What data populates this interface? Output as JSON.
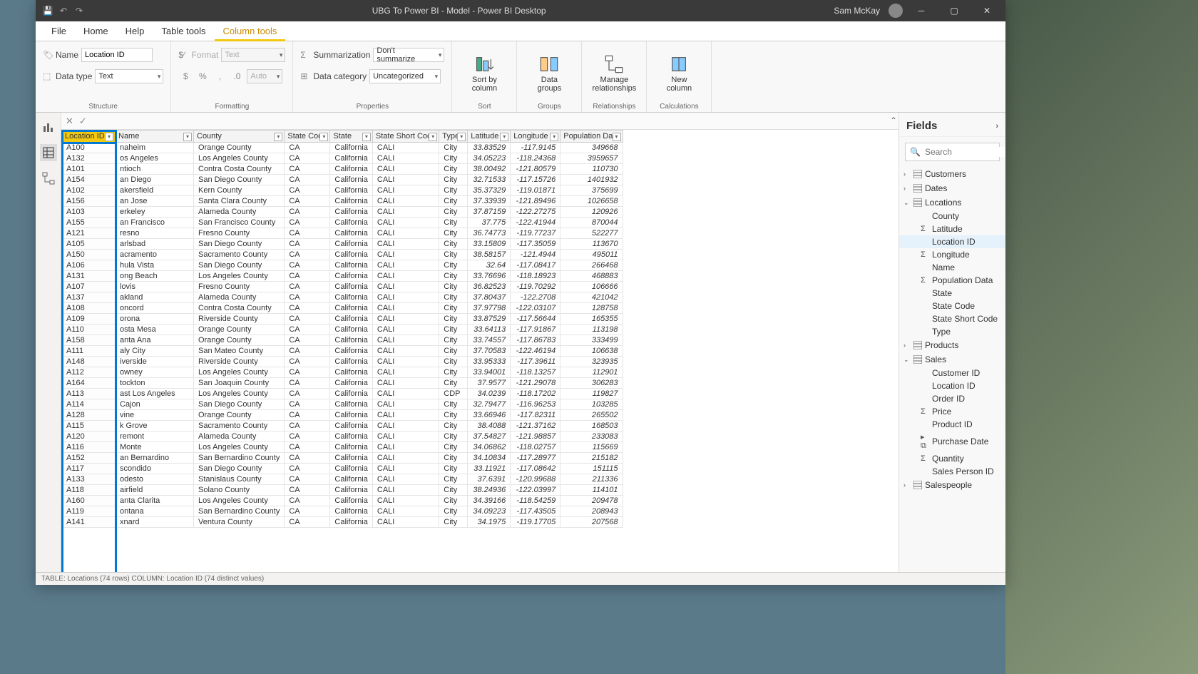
{
  "titlebar": {
    "title": "UBG To Power BI - Model - Power BI Desktop",
    "user": "Sam McKay"
  },
  "ribbon": {
    "tabs": [
      "File",
      "Home",
      "Help",
      "Table tools",
      "Column tools"
    ],
    "active_tab": "Column tools",
    "name_label": "Name",
    "name_value": "Location ID",
    "datatype_label": "Data type",
    "datatype_value": "Text",
    "format_label": "Format",
    "format_value": "Text",
    "auto_value": "Auto",
    "summarization_label": "Summarization",
    "summarization_value": "Don't summarize",
    "datacat_label": "Data category",
    "datacat_value": "Uncategorized",
    "sort_label": "Sort by\ncolumn",
    "groups_label": "Data\ngroups",
    "manage_label": "Manage\nrelationships",
    "newcol_label": "New\ncolumn",
    "grp_structure": "Structure",
    "grp_formatting": "Formatting",
    "grp_properties": "Properties",
    "grp_sort": "Sort",
    "grp_groups": "Groups",
    "grp_rel": "Relationships",
    "grp_calc": "Calculations"
  },
  "columns": [
    "Location ID",
    "Name",
    "County",
    "State Code",
    "State",
    "State Short Code",
    "Type",
    "Latitude",
    "Longitude",
    "Population Data"
  ],
  "rows": [
    [
      "A100",
      "naheim",
      "Orange County",
      "CA",
      "California",
      "CALI",
      "City",
      "33.83529",
      "-117.9145",
      "349668"
    ],
    [
      "A132",
      "os Angeles",
      "Los Angeles County",
      "CA",
      "California",
      "CALI",
      "City",
      "34.05223",
      "-118.24368",
      "3959657"
    ],
    [
      "A101",
      "ntioch",
      "Contra Costa County",
      "CA",
      "California",
      "CALI",
      "City",
      "38.00492",
      "-121.80579",
      "110730"
    ],
    [
      "A154",
      "an Diego",
      "San Diego County",
      "CA",
      "California",
      "CALI",
      "City",
      "32.71533",
      "-117.15726",
      "1401932"
    ],
    [
      "A102",
      "akersfield",
      "Kern County",
      "CA",
      "California",
      "CALI",
      "City",
      "35.37329",
      "-119.01871",
      "375699"
    ],
    [
      "A156",
      "an Jose",
      "Santa Clara County",
      "CA",
      "California",
      "CALI",
      "City",
      "37.33939",
      "-121.89496",
      "1026658"
    ],
    [
      "A103",
      "erkeley",
      "Alameda County",
      "CA",
      "California",
      "CALI",
      "City",
      "37.87159",
      "-122.27275",
      "120926"
    ],
    [
      "A155",
      "an Francisco",
      "San Francisco County",
      "CA",
      "California",
      "CALI",
      "City",
      "37.775",
      "-122.41944",
      "870044"
    ],
    [
      "A121",
      "resno",
      "Fresno County",
      "CA",
      "California",
      "CALI",
      "City",
      "36.74773",
      "-119.77237",
      "522277"
    ],
    [
      "A105",
      "arlsbad",
      "San Diego County",
      "CA",
      "California",
      "CALI",
      "City",
      "33.15809",
      "-117.35059",
      "113670"
    ],
    [
      "A150",
      "acramento",
      "Sacramento County",
      "CA",
      "California",
      "CALI",
      "City",
      "38.58157",
      "-121.4944",
      "495011"
    ],
    [
      "A106",
      "hula Vista",
      "San Diego County",
      "CA",
      "California",
      "CALI",
      "City",
      "32.64",
      "-117.08417",
      "266468"
    ],
    [
      "A131",
      "ong Beach",
      "Los Angeles County",
      "CA",
      "California",
      "CALI",
      "City",
      "33.76696",
      "-118.18923",
      "468883"
    ],
    [
      "A107",
      "lovis",
      "Fresno County",
      "CA",
      "California",
      "CALI",
      "City",
      "36.82523",
      "-119.70292",
      "106666"
    ],
    [
      "A137",
      "akland",
      "Alameda County",
      "CA",
      "California",
      "CALI",
      "City",
      "37.80437",
      "-122.2708",
      "421042"
    ],
    [
      "A108",
      "oncord",
      "Contra Costa County",
      "CA",
      "California",
      "CALI",
      "City",
      "37.97798",
      "-122.03107",
      "128758"
    ],
    [
      "A109",
      "orona",
      "Riverside County",
      "CA",
      "California",
      "CALI",
      "City",
      "33.87529",
      "-117.56644",
      "165355"
    ],
    [
      "A110",
      "osta Mesa",
      "Orange County",
      "CA",
      "California",
      "CALI",
      "City",
      "33.64113",
      "-117.91867",
      "113198"
    ],
    [
      "A158",
      "anta Ana",
      "Orange County",
      "CA",
      "California",
      "CALI",
      "City",
      "33.74557",
      "-117.86783",
      "333499"
    ],
    [
      "A111",
      "aly City",
      "San Mateo County",
      "CA",
      "California",
      "CALI",
      "City",
      "37.70583",
      "-122.46194",
      "106638"
    ],
    [
      "A148",
      "iverside",
      "Riverside County",
      "CA",
      "California",
      "CALI",
      "City",
      "33.95333",
      "-117.39611",
      "323935"
    ],
    [
      "A112",
      "owney",
      "Los Angeles County",
      "CA",
      "California",
      "CALI",
      "City",
      "33.94001",
      "-118.13257",
      "112901"
    ],
    [
      "A164",
      "tockton",
      "San Joaquin County",
      "CA",
      "California",
      "CALI",
      "City",
      "37.9577",
      "-121.29078",
      "306283"
    ],
    [
      "A113",
      "ast Los Angeles",
      "Los Angeles County",
      "CA",
      "California",
      "CALI",
      "CDP",
      "34.0239",
      "-118.17202",
      "119827"
    ],
    [
      "A114",
      " Cajon",
      "San Diego County",
      "CA",
      "California",
      "CALI",
      "City",
      "32.79477",
      "-116.96253",
      "103285"
    ],
    [
      "A128",
      "vine",
      "Orange County",
      "CA",
      "California",
      "CALI",
      "City",
      "33.66946",
      "-117.82311",
      "265502"
    ],
    [
      "A115",
      "k Grove",
      "Sacramento County",
      "CA",
      "California",
      "CALI",
      "City",
      "38.4088",
      "-121.37162",
      "168503"
    ],
    [
      "A120",
      "remont",
      "Alameda County",
      "CA",
      "California",
      "CALI",
      "City",
      "37.54827",
      "-121.98857",
      "233083"
    ],
    [
      "A116",
      " Monte",
      "Los Angeles County",
      "CA",
      "California",
      "CALI",
      "City",
      "34.06862",
      "-118.02757",
      "115669"
    ],
    [
      "A152",
      "an Bernardino",
      "San Bernardino County",
      "CA",
      "California",
      "CALI",
      "City",
      "34.10834",
      "-117.28977",
      "215182"
    ],
    [
      "A117",
      "scondido",
      "San Diego County",
      "CA",
      "California",
      "CALI",
      "City",
      "33.11921",
      "-117.08642",
      "151115"
    ],
    [
      "A133",
      "odesto",
      "Stanislaus County",
      "CA",
      "California",
      "CALI",
      "City",
      "37.6391",
      "-120.99688",
      "211336"
    ],
    [
      "A118",
      "airfield",
      "Solano County",
      "CA",
      "California",
      "CALI",
      "City",
      "38.24936",
      "-122.03997",
      "114101"
    ],
    [
      "A160",
      "anta Clarita",
      "Los Angeles County",
      "CA",
      "California",
      "CALI",
      "City",
      "34.39166",
      "-118.54259",
      "209478"
    ],
    [
      "A119",
      "ontana",
      "San Bernardino County",
      "CA",
      "California",
      "CALI",
      "City",
      "34.09223",
      "-117.43505",
      "208943"
    ],
    [
      "A141",
      "xnard",
      "Ventura County",
      "CA",
      "California",
      "CALI",
      "City",
      "34.1975",
      "-119.17705",
      "207568"
    ]
  ],
  "fields": {
    "header": "Fields",
    "search_placeholder": "Search",
    "tables": [
      {
        "name": "Customers",
        "expanded": false
      },
      {
        "name": "Dates",
        "expanded": false
      },
      {
        "name": "Locations",
        "expanded": true,
        "fields": [
          {
            "name": "County"
          },
          {
            "name": "Latitude",
            "sigma": true
          },
          {
            "name": "Location ID",
            "selected": true
          },
          {
            "name": "Longitude",
            "sigma": true
          },
          {
            "name": "Name"
          },
          {
            "name": "Population Data",
            "sigma": true
          },
          {
            "name": "State"
          },
          {
            "name": "State Code"
          },
          {
            "name": "State Short Code"
          },
          {
            "name": "Type"
          }
        ]
      },
      {
        "name": "Products",
        "expanded": false
      },
      {
        "name": "Sales",
        "expanded": true,
        "fields": [
          {
            "name": "Customer ID"
          },
          {
            "name": "Location ID"
          },
          {
            "name": "Order ID"
          },
          {
            "name": "Price",
            "sigma": true
          },
          {
            "name": "Product ID"
          },
          {
            "name": "Purchase Date",
            "hier": true
          },
          {
            "name": "Quantity",
            "sigma": true
          },
          {
            "name": "Sales Person ID"
          }
        ]
      },
      {
        "name": "Salespeople",
        "expanded": false
      }
    ]
  },
  "statusbar": "TABLE: Locations (74 rows)  COLUMN: Location ID (74 distinct values)"
}
